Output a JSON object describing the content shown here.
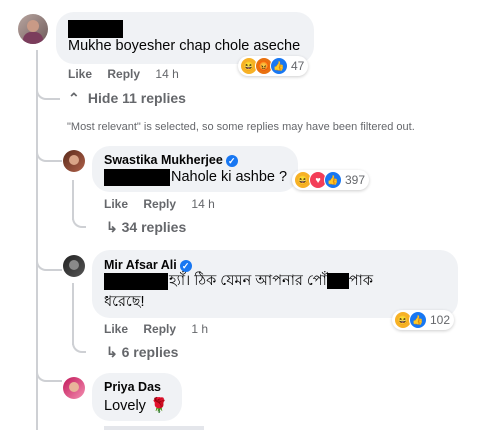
{
  "comments": [
    {
      "author": "",
      "text": "Mukhe boyesher chap chole aseche",
      "like": "Like",
      "reply": "Reply",
      "time": "14 h",
      "reaction_count": "47",
      "reactions": [
        "haha-icon",
        "angry-icon",
        "like-icon"
      ]
    }
  ],
  "hide_replies": "Hide 11 replies",
  "filter_notice": "\"Most relevant\" is selected, so some replies may have been filtered out.",
  "replies": [
    {
      "author": "Swastika Mukherjee",
      "text": "Nahole ki ashbe ?",
      "like": "Like",
      "reply": "Reply",
      "time": "14 h",
      "reaction_count": "397",
      "more_replies": "34 replies"
    },
    {
      "author": "Mir Afsar Ali",
      "text_line1_a": "হ্যাঁ। ঠিক যেমন আপনার পোঁ",
      "text_line1_b": "পাক",
      "text_line2": "ধরেছে!",
      "like": "Like",
      "reply": "Reply",
      "time": "1 h",
      "reaction_count": "102",
      "more_replies": "6 replies"
    },
    {
      "author": "Priya Das",
      "text": "Lovely 🌹"
    }
  ]
}
